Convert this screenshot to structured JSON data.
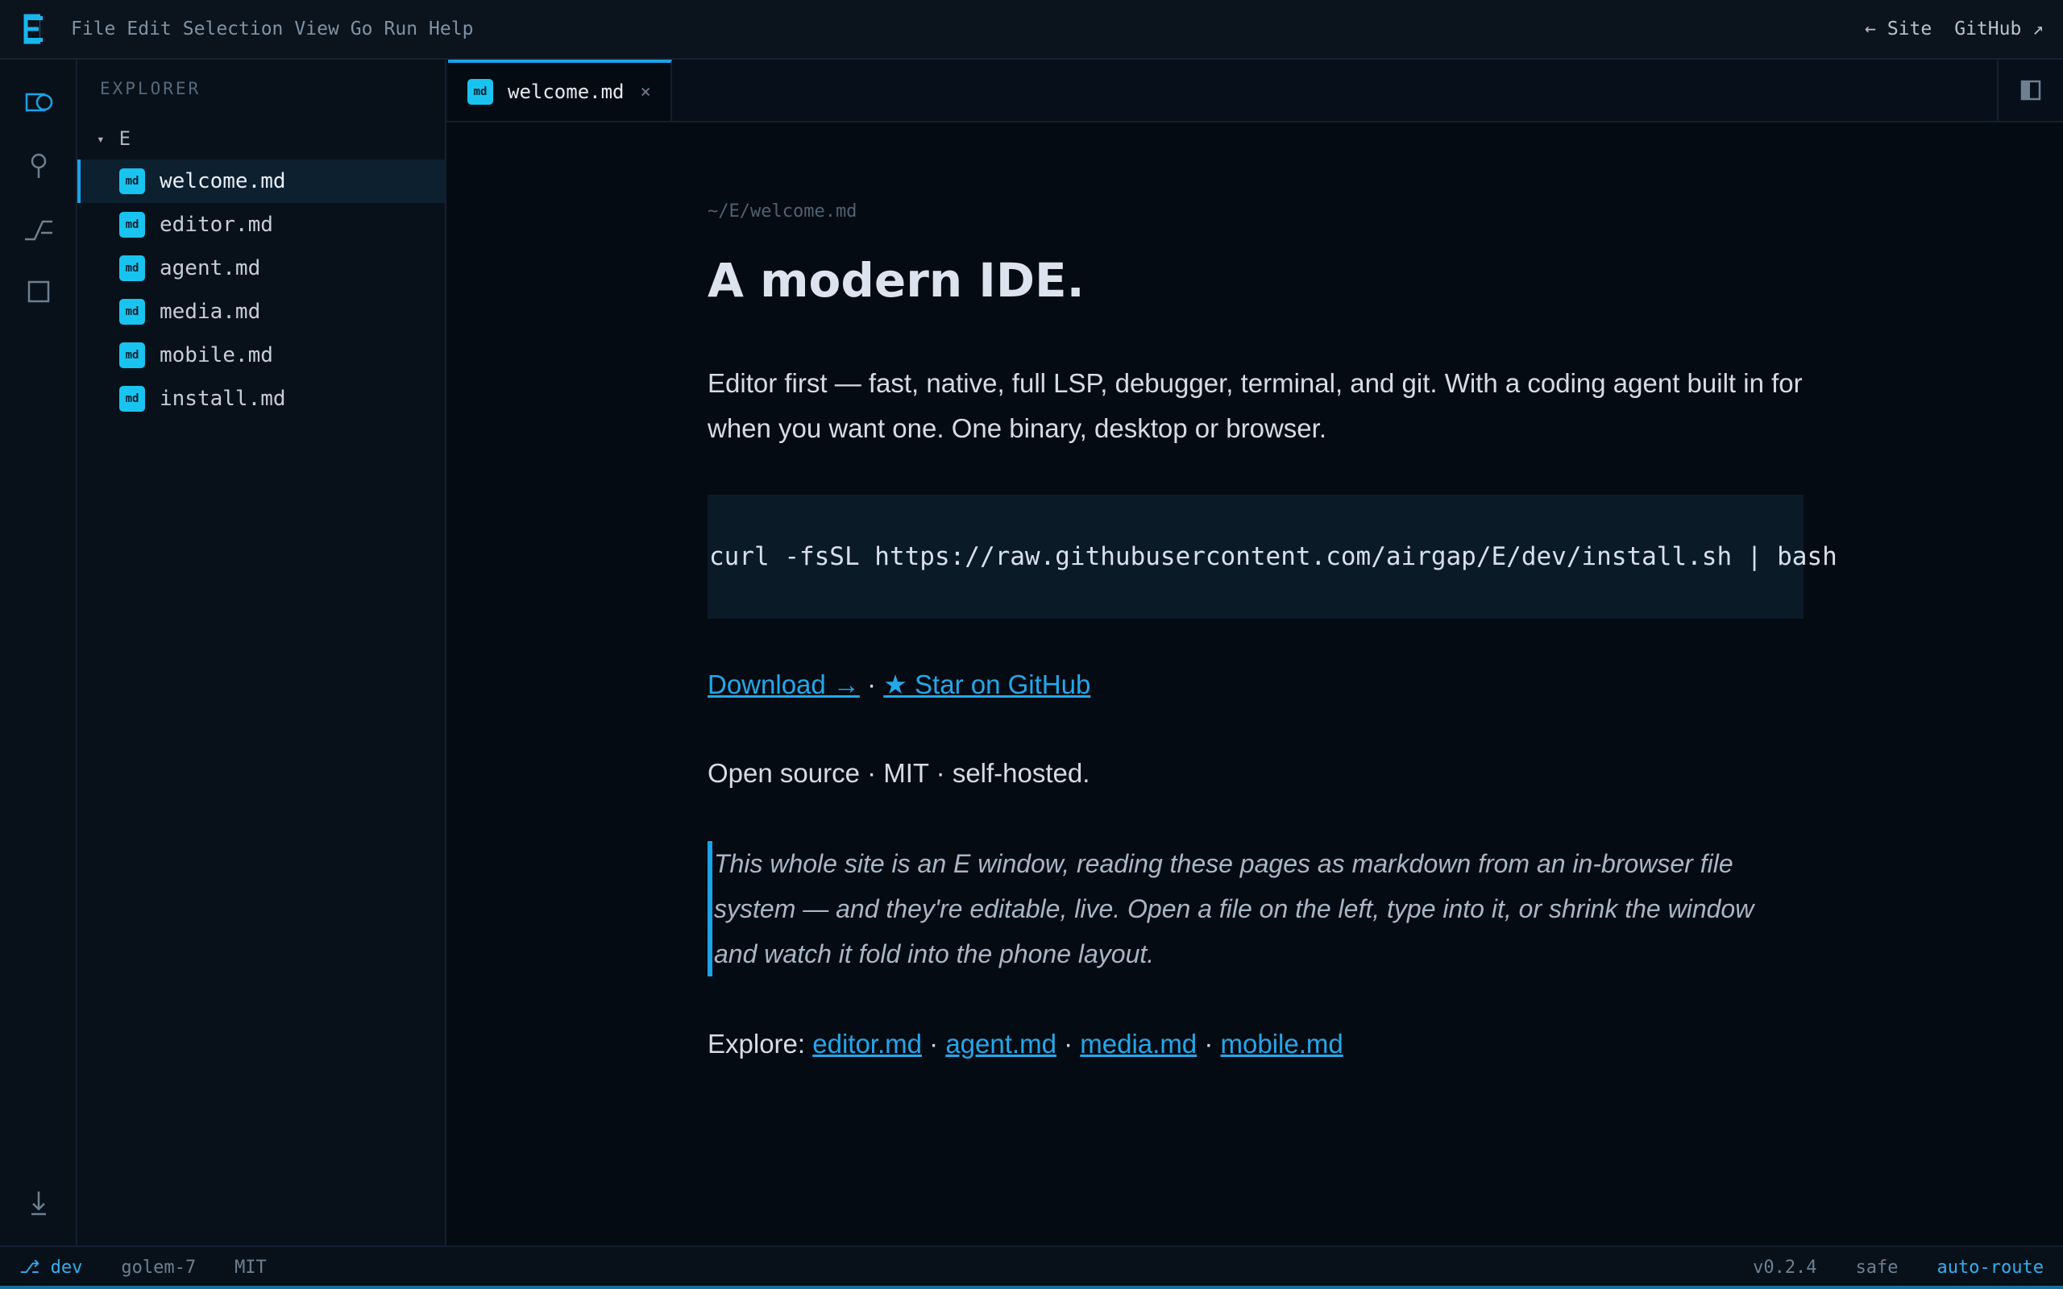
{
  "titlebar": {
    "logo_letter": "E",
    "menu": [
      "File",
      "Edit",
      "Selection",
      "View",
      "Go",
      "Run",
      "Help"
    ],
    "site_link": "← Site",
    "github_link": "GitHub ↗"
  },
  "activitybar": {
    "icons": [
      "explorer-icon",
      "search-icon",
      "source-control-icon",
      "extensions-icon",
      "download-icon"
    ]
  },
  "sidebar": {
    "title": "EXPLORER",
    "root_caret": "▾",
    "root": "E",
    "badge": "md",
    "files": [
      {
        "name": "welcome.md",
        "active": true
      },
      {
        "name": "editor.md",
        "active": false
      },
      {
        "name": "agent.md",
        "active": false
      },
      {
        "name": "media.md",
        "active": false
      },
      {
        "name": "mobile.md",
        "active": false
      },
      {
        "name": "install.md",
        "active": false
      }
    ]
  },
  "tabs": {
    "active": {
      "badge": "md",
      "label": "welcome.md",
      "close": "×"
    }
  },
  "doc": {
    "path": "~/E/welcome.md",
    "heading": "A modern IDE.",
    "intro": "Editor first — fast, native, full LSP, debugger, terminal, and git. With a coding agent built in for when you want one. One binary, desktop or browser.",
    "install_cmd": "curl -fsSL https://raw.githubusercontent.com/airgap/E/dev/install.sh | bash",
    "download_link": "Download →",
    "link_sep": "·",
    "star_link": "★ Star on GitHub",
    "license_line": "Open source · MIT · self-hosted.",
    "quote": "This whole site is an E window, reading these pages as markdown from an in-browser file system — and they're editable, live. Open a file on the left, type into it, or shrink the window and watch it fold into the phone layout.",
    "explore_label": "Explore: ",
    "explore_links": [
      "editor.md",
      "agent.md",
      "media.md",
      "mobile.md"
    ]
  },
  "statusbar": {
    "branch": "⎇ dev",
    "host": "golem-7",
    "license": "MIT",
    "version": "v0.2.4",
    "mode": "safe",
    "route": "auto-route"
  },
  "colors": {
    "accent": "#1aa3e8",
    "badge": "#18c4ef",
    "link": "#23a8ea",
    "background": "#050b12"
  }
}
